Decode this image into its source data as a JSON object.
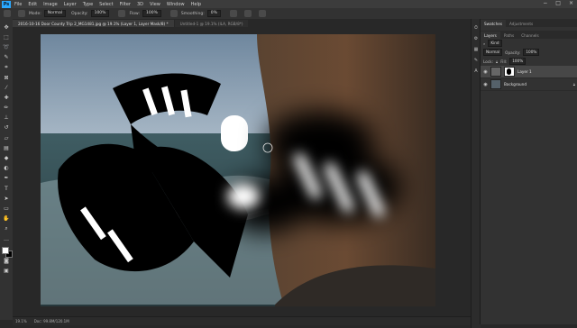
{
  "app": {
    "logo": "Ps",
    "menu": [
      "File",
      "Edit",
      "Image",
      "Layer",
      "Type",
      "Select",
      "Filter",
      "3D",
      "View",
      "Window",
      "Help"
    ],
    "window_controls": [
      "−",
      "□",
      "×"
    ]
  },
  "options": {
    "mode_label": "Mode:",
    "mode_value": "Normal",
    "opacity_label": "Opacity:",
    "opacity_value": "100%",
    "flow_label": "Flow:",
    "flow_value": "100%",
    "smoothing_label": "Smoothing:",
    "smoothing_value": "0%"
  },
  "tabs": [
    {
      "label": "2016-10-16 Door County Trip 2_MG1481.jpg @ 19.1% (Layer 1, Layer Mask/8) *",
      "active": true
    },
    {
      "label": "Untitled-1 @ 19.1% (ILA, RGB/8*)",
      "active": false
    }
  ],
  "status": {
    "zoom": "19.1%",
    "doc": "Doc: 99.8M/120.1M"
  },
  "panels": {
    "top_tabs": [
      "Swatches",
      "Adjustments"
    ],
    "layer_tabs": [
      "Layers",
      "Paths",
      "Channels"
    ],
    "kind_label": "Kind",
    "blend_mode": "Normal",
    "opacity_label": "Opacity:",
    "opacity_value": "100%",
    "lock_label": "Lock:",
    "fill_label": "Fill:",
    "fill_value": "100%",
    "layers": [
      {
        "name": "Layer 1",
        "selected": true
      },
      {
        "name": "Background",
        "selected": false
      }
    ]
  },
  "colors": {
    "accent": "#2aa8ff",
    "panel": "#323232",
    "canvas_bg": "#282828"
  }
}
